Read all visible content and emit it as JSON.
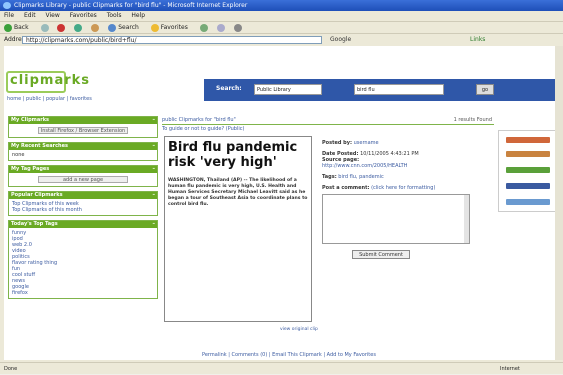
{
  "window": {
    "title": "Clipmarks Library - public Clipmarks for \"bird flu\" - Microsoft Internet Explorer"
  },
  "menu": [
    "File",
    "Edit",
    "View",
    "Favorites",
    "Tools",
    "Help"
  ],
  "toolbar": {
    "back": "Back",
    "search": "Search",
    "favorites": "Favorites"
  },
  "address": {
    "label": "Address",
    "url": "http://clipmarks.com/public/bird+flu/",
    "go": "Go",
    "links": "Links",
    "google": "Google"
  },
  "header": {
    "logo": "clipmarks",
    "nav": "home | public | popular | favorites",
    "search_label": "Search:",
    "search_scope": "Public Library",
    "search_query": "bird flu",
    "search_go": "go"
  },
  "sidebar": {
    "box1": {
      "title": "My Clipmarks",
      "button": "Install Firefox / Browser Extension"
    },
    "box2": {
      "title": "My Recent Searches",
      "item": "none"
    },
    "box3": {
      "title": "My Tag Pages",
      "button": "add a new page"
    },
    "box4": {
      "title": "Popular Clipmarks",
      "items": [
        "Top Clipmarks of this week",
        "Top Clipmarks of this month"
      ]
    },
    "box5": {
      "title": "Today's Top Tags",
      "items": [
        "funny",
        "ipod",
        "web 2.0",
        "video",
        "politics",
        "flavor rating thing",
        "fun",
        "cool stuff",
        "news",
        "google",
        "firefox"
      ]
    }
  },
  "main": {
    "heading": "public Clipmarks for \"bird flu\"",
    "results": "1 results Found",
    "subheading": "To guide or not to guide? (Public)",
    "headline": "Bird flu pandemic risk 'very high'",
    "body": "WASHINGTON, Thailand (AP) -- The likelihood of a human flu pandemic is very high, U.S. Health and Human Services Secretary Michael Leavitt said as he began a tour of Southeast Asia to coordinate plans to control bird flu.",
    "posted_by_label": "Posted by:",
    "posted_by": "username",
    "date_label": "Date Posted:",
    "date": "10/11/2005 4:43:21 PM",
    "source_label": "Source page:",
    "source": "http://www.cnn.com/2005/HEALTH",
    "tags_label": "Tags:",
    "tags": "bird flu, pandemic",
    "comment_label": "Post a comment:",
    "comment_note": "(click here for formatting)",
    "submit": "Submit Comment",
    "original": "view original clip",
    "footer": "Permalink | Comments (0) | Email This Clipmark | Add to My Favorites"
  },
  "status": {
    "text": "Done",
    "zone": "Internet"
  }
}
